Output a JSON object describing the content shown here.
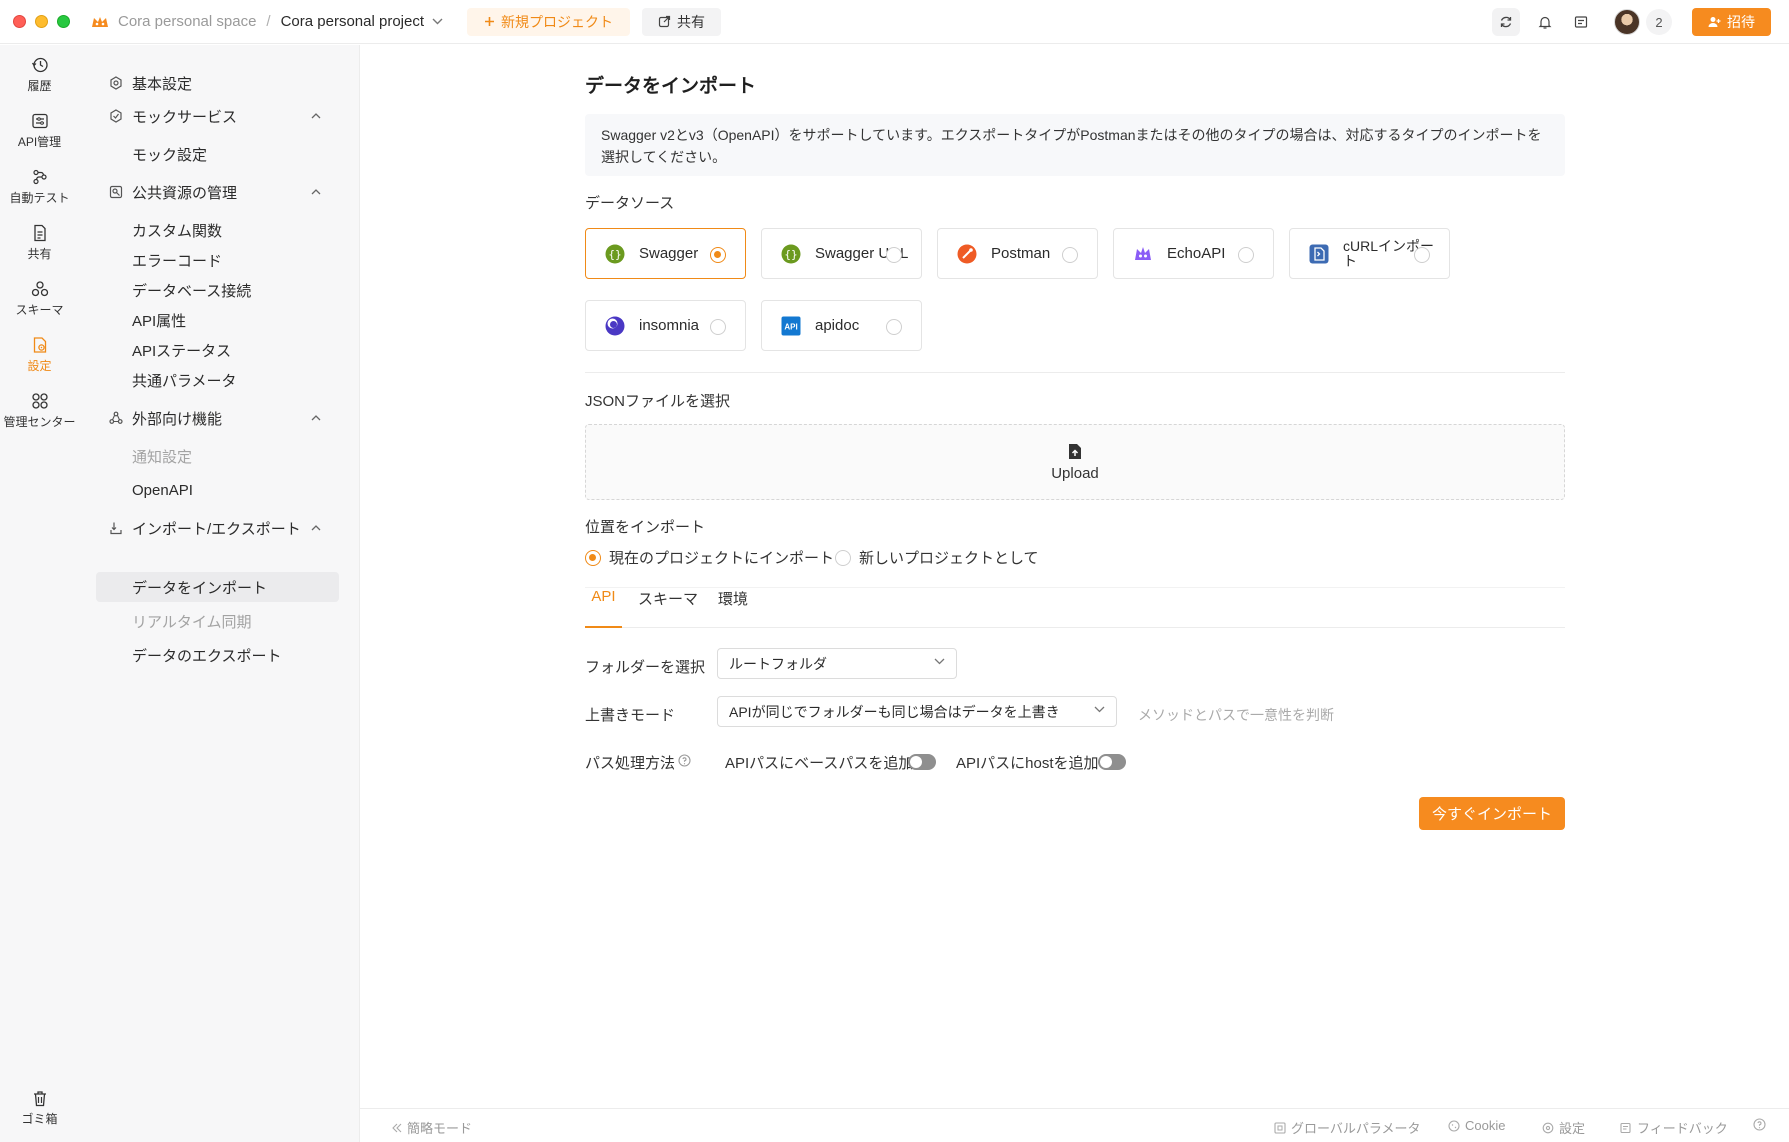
{
  "window": {
    "controls": [
      "close",
      "minimize",
      "maximize"
    ]
  },
  "topbar": {
    "space_name": "Cora personal space",
    "separator": "/",
    "project_name": "Cora personal project",
    "new_project_label": "新規プロジェクト",
    "share_label": "共有",
    "member_count": "2",
    "invite_label": "招待",
    "icons": [
      "sync-icon",
      "bell-icon",
      "document-icon"
    ]
  },
  "rail": {
    "items": [
      {
        "label": "履歴",
        "icon": "history-icon"
      },
      {
        "label": "API管理",
        "icon": "api-icon"
      },
      {
        "label": "自動テスト",
        "icon": "autotest-icon"
      },
      {
        "label": "共有",
        "icon": "share-doc-icon"
      },
      {
        "label": "スキーマ",
        "icon": "schema-icon"
      },
      {
        "label": "設定",
        "icon": "settings-icon",
        "active": true
      },
      {
        "label": "管理センター",
        "icon": "grid-icon"
      }
    ],
    "trash_label": "ゴミ箱"
  },
  "settings_nav": {
    "basic": "基本設定",
    "mock_group": "モックサービス",
    "mock_settings": "モック設定",
    "public_group": "公共資源の管理",
    "custom_functions": "カスタム関数",
    "error_codes": "エラーコード",
    "db_connection": "データベース接続",
    "api_attributes": "API属性",
    "api_status": "APIステータス",
    "common_params": "共通パラメータ",
    "external_group": "外部向け機能",
    "notification_settings": "通知設定",
    "openapi": "OpenAPI",
    "import_export_group": "インポート/エクスポート",
    "import_data": "データをインポート",
    "realtime_sync": "リアルタイム同期",
    "export_data": "データのエクスポート"
  },
  "main": {
    "title": "データをインポート",
    "info": "Swagger v2とv3（OpenAPI）をサポートしています。エクスポートタイプがPostmanまたはその他のタイプの場合は、対応するタイプのインポートを選択してください。",
    "data_source_label": "データソース",
    "sources": [
      {
        "name": "Swagger",
        "icon": "swagger-icon",
        "selected": true
      },
      {
        "name": "Swagger URL",
        "icon": "swagger-url-icon",
        "selected": false
      },
      {
        "name": "Postman",
        "icon": "postman-icon",
        "selected": false
      },
      {
        "name": "EchoAPI",
        "icon": "echoapi-icon",
        "selected": false
      },
      {
        "name": "cURLインポート",
        "icon": "curl-icon",
        "selected": false
      },
      {
        "name": "insomnia",
        "icon": "insomnia-icon",
        "selected": false
      },
      {
        "name": "apidoc",
        "icon": "apidoc-icon",
        "selected": false
      }
    ],
    "apidoc_badge": "API",
    "json_file_label": "JSONファイルを選択",
    "upload_label": "Upload",
    "import_location_label": "位置をインポート",
    "location_options": [
      {
        "label": "現在のプロジェクトにインポート",
        "selected": true
      },
      {
        "label": "新しいプロジェクトとして",
        "selected": false
      }
    ],
    "tabs": [
      {
        "label": "API",
        "active": true
      },
      {
        "label": "スキーマ",
        "active": false
      },
      {
        "label": "環境",
        "active": false
      }
    ],
    "folder_label": "フォルダーを選択",
    "folder_value": "ルートフォルダ",
    "overwrite_label": "上書きモード",
    "overwrite_value": "APIが同じでフォルダーも同じ場合はデータを上書き",
    "overwrite_hint": "メソッドとパスで一意性を判断",
    "path_label": "パス処理方法",
    "toggle_basepath_label": "APIパスにベースパスを追加",
    "toggle_basepath_on": false,
    "toggle_host_label": "APIパスにhostを追加",
    "toggle_host_on": false,
    "import_button": "今すぐインポート"
  },
  "statusbar": {
    "simple_mode": "簡略モード",
    "global_params": "グローバルパラメータ",
    "cookie": "Cookie",
    "settings": "設定",
    "feedback": "フィードバック"
  },
  "colors": {
    "accent": "#f68b1f",
    "accent_text": "#f08a17"
  }
}
